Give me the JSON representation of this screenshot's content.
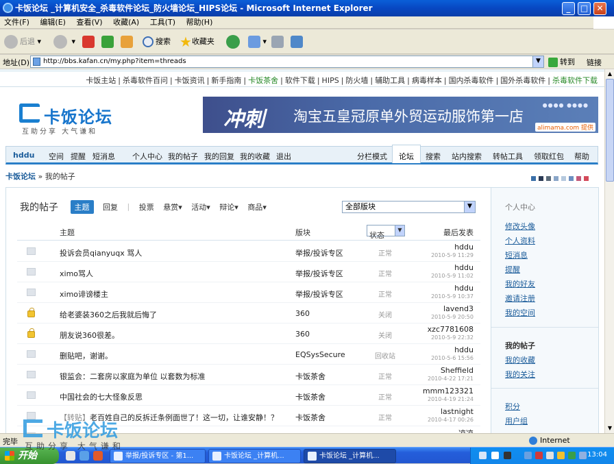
{
  "window": {
    "title": "卡饭论坛 _计算机安全_杀毒软件论坛_防火墙论坛_HIPS论坛 - Microsoft Internet Explorer"
  },
  "menu": [
    "文件(F)",
    "编辑(E)",
    "查看(V)",
    "收藏(A)",
    "工具(T)",
    "帮助(H)"
  ],
  "toolbar": {
    "back": "后退",
    "search": "搜索",
    "favorites": "收藏夹"
  },
  "address": {
    "label": "地址(D)",
    "url": "http://bbs.kafan.cn/my.php?item=threads",
    "go": "转到",
    "links": "链接"
  },
  "site_nav": [
    {
      "label": "卡饭主站"
    },
    {
      "label": "杀毒软件百问"
    },
    {
      "label": "卡饭资讯"
    },
    {
      "label": "新手指南"
    },
    {
      "label": "卡饭茶舍",
      "green": true
    },
    {
      "label": "软件下载"
    },
    {
      "label": "HIPS"
    },
    {
      "label": "防火墙"
    },
    {
      "label": "辅助工具"
    },
    {
      "label": "病毒样本"
    },
    {
      "label": "国内杀毒软件"
    },
    {
      "label": "国外杀毒软件"
    },
    {
      "label": "杀毒软件下载",
      "green": true
    }
  ],
  "logo": {
    "name": "卡饭论坛",
    "slogan": "互助分享 大气谦和"
  },
  "banner": {
    "big": "冲刺",
    "text": "淘宝五皇冠原单外贸运动服饰第一店",
    "badge": "alimama.com 提供"
  },
  "main_nav": {
    "user": "hddu",
    "left": [
      "空间",
      "提醒",
      "短消息",
      "个人中心",
      "我的帖子",
      "我的回复",
      "我的收藏",
      "退出"
    ],
    "right": [
      "分栏模式",
      "论坛",
      "搜索",
      "站内搜索",
      "转帖工具",
      "领取红包",
      "帮助"
    ],
    "active": "论坛"
  },
  "breadcrumb": {
    "home": "卡饭论坛",
    "current": "» 我的帖子"
  },
  "style_colors": [
    "#3a6fa8",
    "#2b3a55",
    "#5b6b7a",
    "#8aa6c8",
    "#b5c9de",
    "#6c8fc0",
    "#c25a7a",
    "#d44a5a"
  ],
  "threads_panel": {
    "title": "我的帖子",
    "tabs": [
      "主题",
      "回复",
      "投票",
      "悬赏",
      "活动",
      "辩论",
      "商品"
    ],
    "active_tab": "主题",
    "forum_select": "全部版块",
    "columns": {
      "subject": "主题",
      "forum": "版块",
      "status": "状态",
      "last": "最后发表"
    }
  },
  "threads": [
    {
      "prefix": "",
      "title": "投诉会员qianyuqx 骂人",
      "forum": "举报/投诉专区",
      "status": "正常",
      "last_user": "hddu",
      "last_time": "2010-5-9 11:29",
      "locked": false
    },
    {
      "prefix": "",
      "title": "ximo骂人",
      "forum": "举报/投诉专区",
      "status": "正常",
      "last_user": "hddu",
      "last_time": "2010-5-9 11:02",
      "locked": false
    },
    {
      "prefix": "",
      "title": "ximo诽谤楼主",
      "forum": "举报/投诉专区",
      "status": "正常",
      "last_user": "hddu",
      "last_time": "2010-5-9 10:37",
      "locked": false
    },
    {
      "prefix": "",
      "title": "给老婆装360之后我就后悔了",
      "forum": "360",
      "status": "关闭",
      "last_user": "lavend3",
      "last_time": "2010-5-9 20:50",
      "locked": true
    },
    {
      "prefix": "",
      "title": "朋友说360很差。",
      "forum": "360",
      "status": "关闭",
      "last_user": "xzc7781608",
      "last_time": "2010-5-9 22:32",
      "locked": true
    },
    {
      "prefix": "",
      "title": "删贴吧，谢谢。",
      "forum": "EQSysSecure",
      "status": "回收站",
      "last_user": "hddu",
      "last_time": "2010-5-6 15:56",
      "locked": false
    },
    {
      "prefix": "",
      "title": "银监会：二套房以家庭为单位 以套数为标准",
      "forum": "卡饭茶舍",
      "status": "正常",
      "last_user": "Sheffield",
      "last_time": "2010-4-22 17:21",
      "locked": false
    },
    {
      "prefix": "",
      "title": "中国社会的七大怪象反思",
      "forum": "卡饭茶舍",
      "status": "正常",
      "last_user": "mmm123321",
      "last_time": "2010-4-19 21:24",
      "locked": false
    },
    {
      "prefix": "【转贴】",
      "title": "老百姓自己的反拆迁条例面世了！这一切，让谁安静！？",
      "forum": "卡饭茶舍",
      "status": "正常",
      "last_user": "lastnight",
      "last_time": "2010-4-17 00:26",
      "locked": false
    },
    {
      "prefix": "",
      "title": "",
      "forum": "",
      "status": "",
      "last_user": "凉凉",
      "last_time": "",
      "locked": false
    }
  ],
  "sidebar": {
    "personal_heading": "个人中心",
    "personal_links": [
      "修改头像",
      "个人资料",
      "短消息",
      "提醒",
      "我的好友",
      "邀请注册",
      "我的空间"
    ],
    "posts_heading": "我的帖子",
    "posts_links": [
      "我的收藏",
      "我的关注"
    ],
    "other_links": [
      "积分",
      "用户组"
    ]
  },
  "status_bar": {
    "done": "完毕",
    "zone": "Internet"
  },
  "taskbar": {
    "start": "开始",
    "tasks": [
      "举报/投诉专区 - 第1...",
      "卡饭论坛 _计算机...",
      "卡饭论坛 _计算机..."
    ],
    "active_task": 2,
    "clock": "13:04"
  },
  "watermark": {
    "name": "卡饭论坛",
    "slogan": "互助分享 大气谦和"
  }
}
